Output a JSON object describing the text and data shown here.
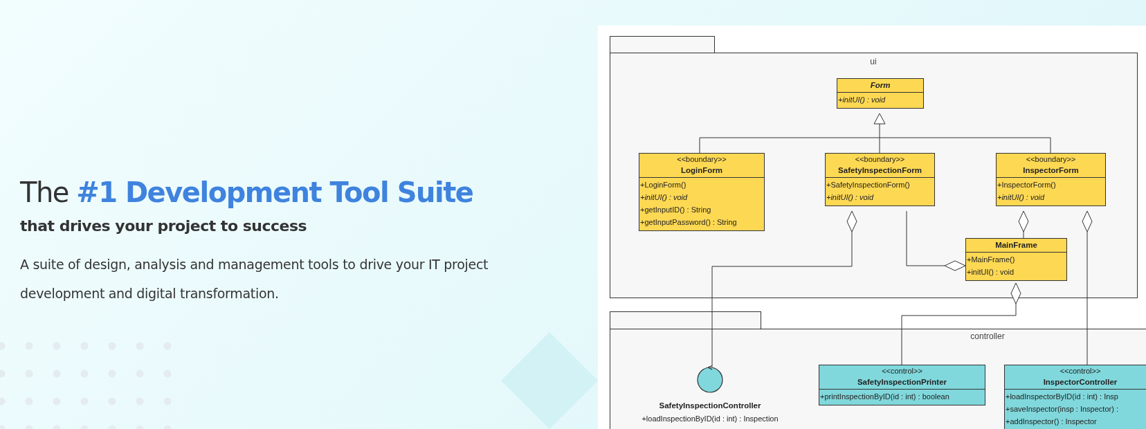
{
  "hero": {
    "title_prefix": "The",
    "title_highlight": "#1 Development Tool Suite",
    "subtitle": "that drives your project to success",
    "description": "A suite of design, analysis and management tools to drive your IT project development and digital transformation."
  },
  "diagram": {
    "packages": [
      {
        "name": "ui",
        "classes": [
          {
            "kind": "class",
            "name": "Form",
            "abstract": true,
            "color": "#fdd853",
            "methods": [
              {
                "text": "+initUI() : void",
                "abstract": true
              }
            ]
          },
          {
            "kind": "class",
            "stereotype": "<<boundary>>",
            "name": "LoginForm",
            "abstract": false,
            "color": "#fdd853",
            "methods": [
              {
                "text": "+LoginForm()",
                "abstract": false
              },
              {
                "text": "+initUI() : void",
                "abstract": true
              },
              {
                "text": "+getInputID() : String",
                "abstract": false
              },
              {
                "text": "+getInputPassword() : String",
                "abstract": false
              }
            ]
          },
          {
            "kind": "class",
            "stereotype": "<<boundary>>",
            "name": "SafetyInspectionForm",
            "abstract": false,
            "color": "#fdd853",
            "methods": [
              {
                "text": "+SafetyInspectionForm()",
                "abstract": false
              },
              {
                "text": "+initUI() : void",
                "abstract": true
              }
            ]
          },
          {
            "kind": "class",
            "stereotype": "<<boundary>>",
            "name": "InspectorForm",
            "abstract": false,
            "color": "#fdd853",
            "methods": [
              {
                "text": "+InspectorForm()",
                "abstract": false
              },
              {
                "text": "+initUI() : void",
                "abstract": true
              }
            ]
          },
          {
            "kind": "class",
            "name": "MainFrame",
            "abstract": false,
            "color": "#fdd853",
            "methods": [
              {
                "text": "+MainFrame()",
                "abstract": false
              },
              {
                "text": "+initUI() : void",
                "abstract": false
              }
            ]
          }
        ]
      },
      {
        "name": "controller",
        "classes": [
          {
            "kind": "control_icon",
            "name": "SafetyInspectionController",
            "abstract": false,
            "color": "#80d8dc",
            "methods": [
              {
                "text": "+loadInspectionByID(id : int) : Inspection",
                "abstract": false
              }
            ]
          },
          {
            "kind": "class",
            "stereotype": "<<control>>",
            "name": "SafetyInspectionPrinter",
            "abstract": false,
            "color": "#80d8dc",
            "methods": [
              {
                "text": "+printInspectionByID(id : int) : boolean",
                "abstract": false
              }
            ]
          },
          {
            "kind": "class",
            "stereotype": "<<control>>",
            "name": "InspectorController",
            "abstract": false,
            "color": "#80d8dc",
            "methods": [
              {
                "text": "+loadInspectorByID(id : int) : Insp",
                "abstract": false
              },
              {
                "text": "+saveInspector(insp : Inspector) :",
                "abstract": false
              },
              {
                "text": "+addInspector() : Inspector",
                "abstract": false
              }
            ]
          }
        ]
      }
    ]
  }
}
